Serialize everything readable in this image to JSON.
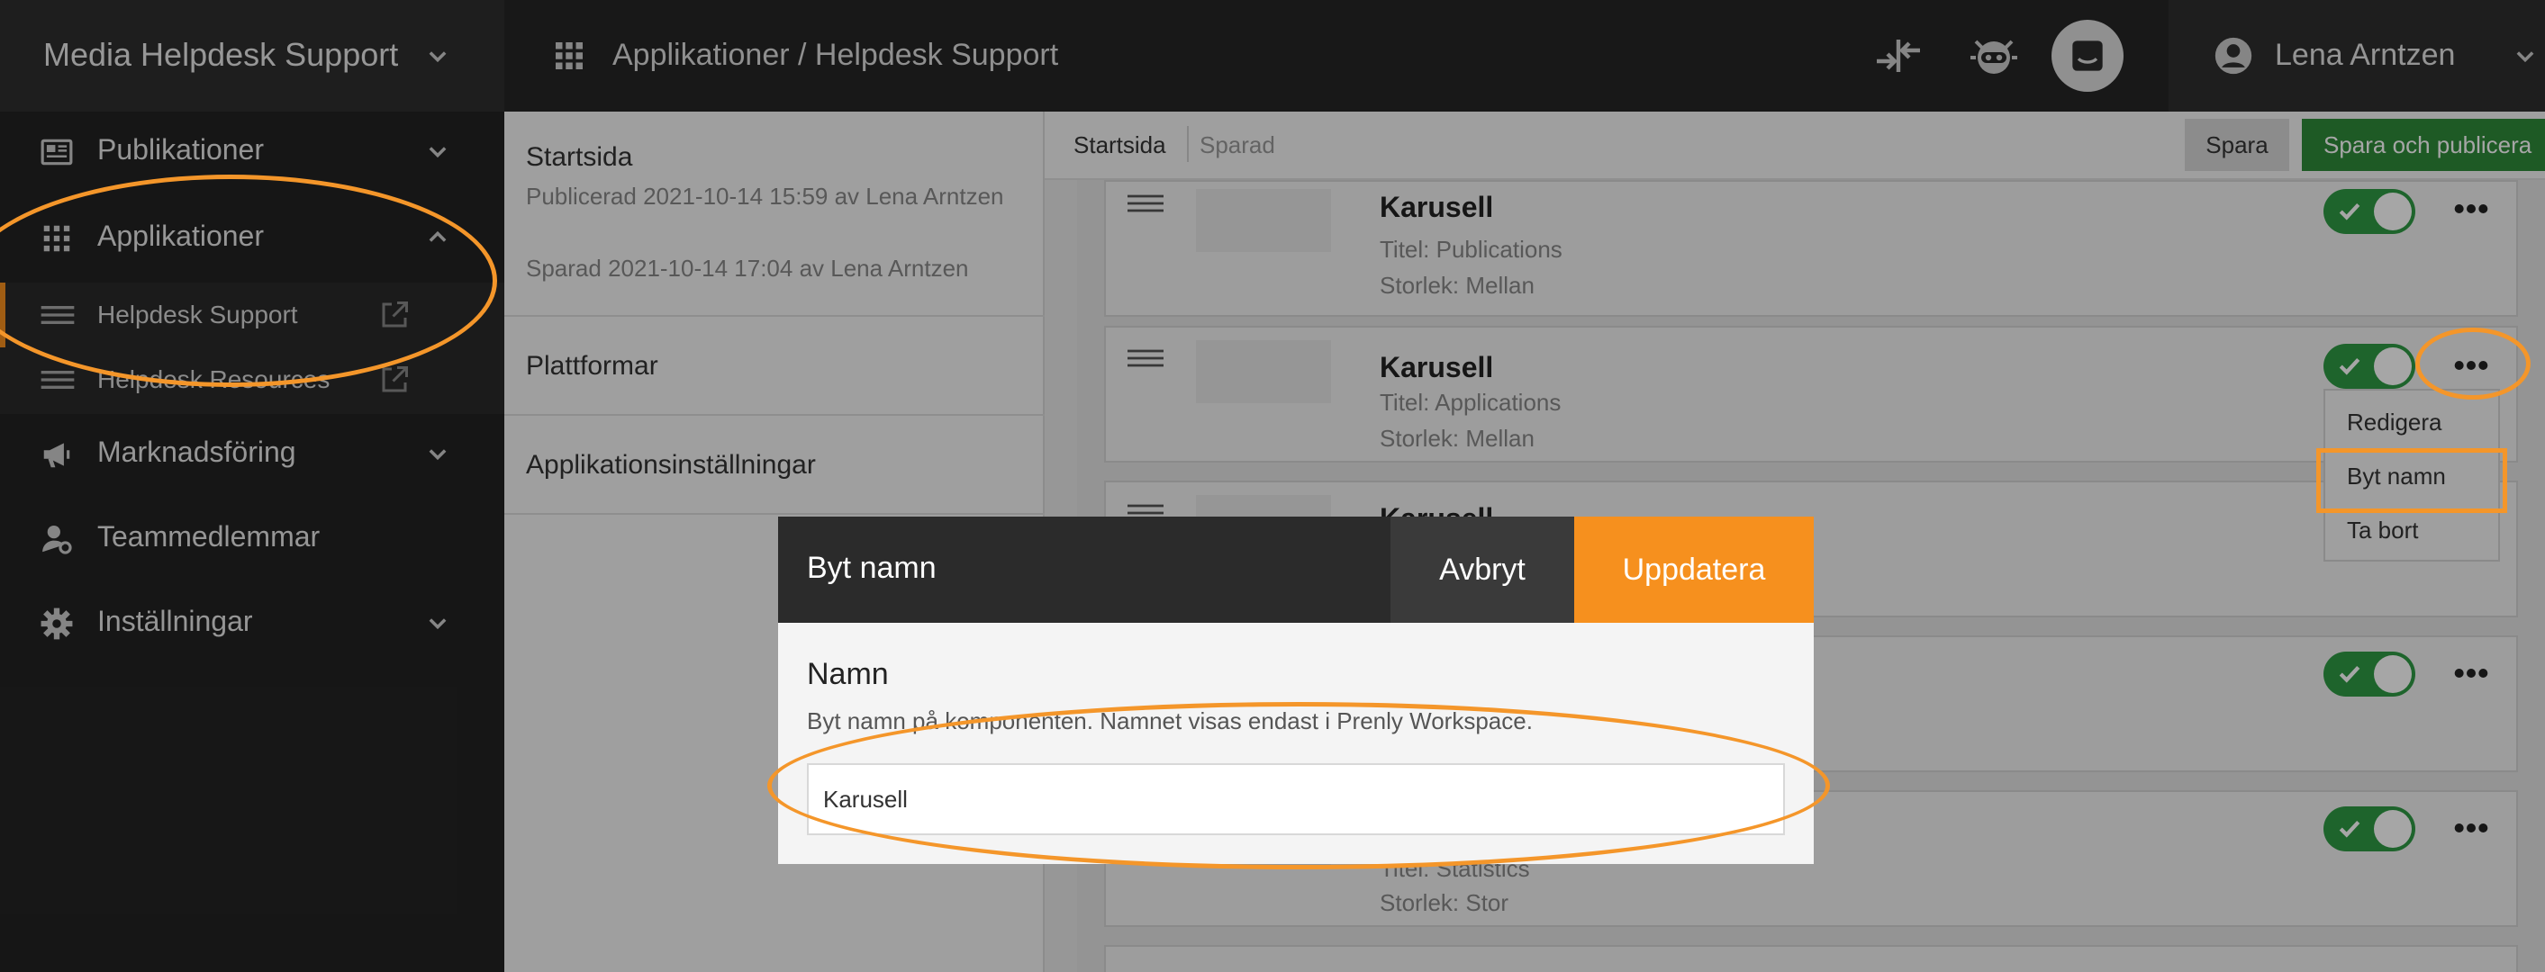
{
  "sidebar": {
    "org_title": "Media Helpdesk Support",
    "items": [
      {
        "label": "Publikationer",
        "icon": "newspaper-icon"
      },
      {
        "label": "Applikationer",
        "icon": "apps-grid-icon"
      },
      {
        "label": "Marknadsföring",
        "icon": "megaphone-icon"
      },
      {
        "label": "Teammedlemmar",
        "icon": "team-member-icon"
      },
      {
        "label": "Inställningar",
        "icon": "gear-icon"
      }
    ],
    "sub_items": [
      {
        "label": "Helpdesk Support"
      },
      {
        "label": "Helpdesk Resources"
      }
    ]
  },
  "topbar": {
    "breadcrumb": "Applikationer / Helpdesk Support",
    "user_name": "Lena Arntzen"
  },
  "left_panel": {
    "page_title": "Startsida",
    "published": "Publicerad 2021-10-14 15:59 av Lena Arntzen",
    "saved": "Sparad 2021-10-14 17:04 av Lena Arntzen",
    "sections": [
      "Plattformar",
      "Applikationsinställningar"
    ]
  },
  "main": {
    "tab_active": "Startsida",
    "tab_status": "Sparad",
    "save_label": "Spara",
    "publish_label": "Spara och publicera",
    "cards": [
      {
        "title": "Karusell",
        "line1": "Titel: Publications",
        "line2": "Storlek: Mellan"
      },
      {
        "title": "Karusell",
        "line1": "Titel: Applications",
        "line2": "Storlek: Mellan"
      },
      {
        "title": "Karusell",
        "line1": "",
        "line2": ""
      },
      {
        "title": "",
        "line1": "",
        "line2": ""
      },
      {
        "title": "",
        "line1": "Titel: Statistics",
        "line2": "Storlek: Stor"
      }
    ],
    "dropdown": [
      "Redigera",
      "Byt namn",
      "Ta bort"
    ]
  },
  "modal": {
    "title": "Byt namn",
    "cancel_label": "Avbryt",
    "update_label": "Uppdatera",
    "field_label": "Namn",
    "field_help": "Byt namn på komponenten. Namnet visas endast i Prenly Workspace.",
    "field_value": "Karusell"
  },
  "colors": {
    "accent": "#f6901e",
    "publish": "#2e8b3a",
    "toggle_on": "#2e9a44",
    "annotation": "#f4962a"
  }
}
